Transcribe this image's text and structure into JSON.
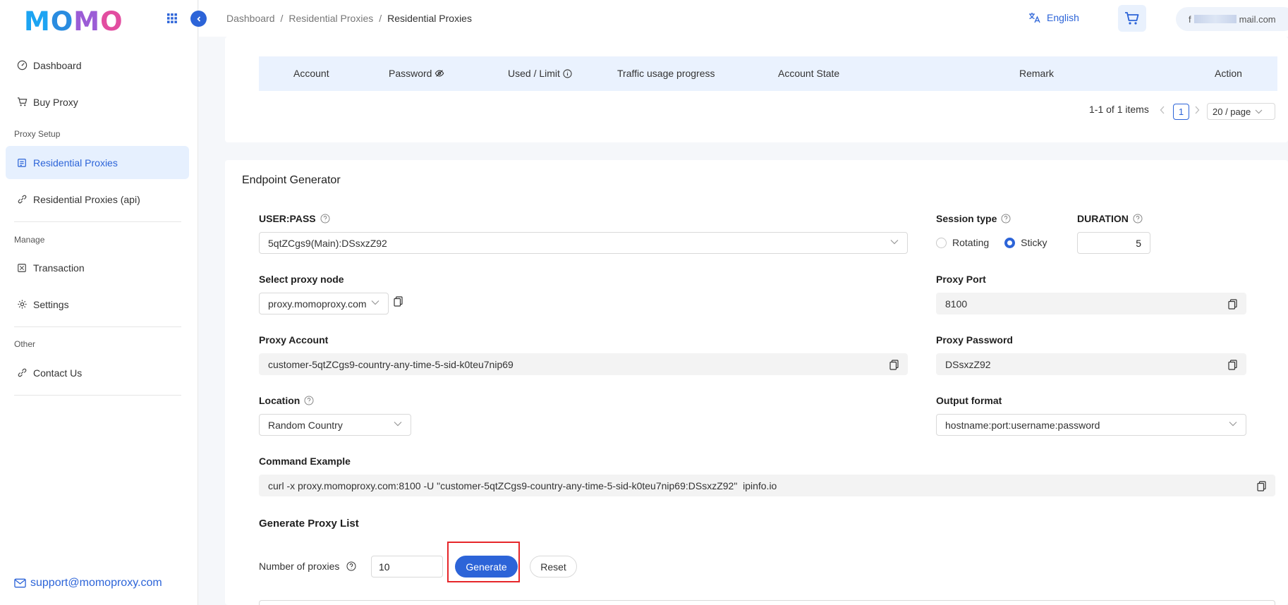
{
  "brand": {
    "logo_letters": [
      "M",
      "O",
      "M",
      "O"
    ]
  },
  "sidebar": {
    "items": [
      {
        "label": "Dashboard",
        "icon": "dashboard-icon"
      },
      {
        "label": "Buy Proxy",
        "icon": "cart-icon"
      },
      {
        "label": "Residential Proxies",
        "icon": "document-icon",
        "active": true
      },
      {
        "label": "Residential Proxies (api)",
        "icon": "api-link-icon"
      },
      {
        "label": "Transaction",
        "icon": "transaction-icon"
      },
      {
        "label": "Settings",
        "icon": "gear-icon"
      },
      {
        "label": "Contact Us",
        "icon": "link-icon"
      }
    ],
    "groups": {
      "proxy_setup": "Proxy Setup",
      "manage": "Manage",
      "other": "Other"
    },
    "support_email": "support@momoproxy.com"
  },
  "header": {
    "breadcrumbs": [
      "Dashboard",
      "/",
      "Residential Proxies",
      "/",
      "Residential Proxies"
    ],
    "language": "English",
    "user_email_prefix": "f",
    "user_email_suffix": "mail.com"
  },
  "accounts_table": {
    "columns": [
      "Account",
      "Password",
      "Used / Limit",
      "Traffic usage progress",
      "Account State",
      "Remark",
      "Action"
    ],
    "pagination": {
      "summary": "1-1 of 1 items",
      "page": "1",
      "page_size": "20 / page"
    }
  },
  "endpoint": {
    "title": "Endpoint Generator",
    "user_pass": {
      "label": "USER:PASS",
      "value": "5qtZCgs9(Main):DSsxzZ92"
    },
    "session_type": {
      "label": "Session type",
      "options": [
        "Rotating",
        "Sticky"
      ],
      "selected": "Sticky"
    },
    "duration": {
      "label": "DURATION",
      "value": "5"
    },
    "proxy_node": {
      "label": "Select proxy node",
      "value": "proxy.momoproxy.com"
    },
    "proxy_port": {
      "label": "Proxy Port",
      "value": "8100"
    },
    "proxy_account": {
      "label": "Proxy Account",
      "value": "customer-5qtZCgs9-country-any-time-5-sid-k0teu7nip69"
    },
    "proxy_password": {
      "label": "Proxy Password",
      "value": "DSsxzZ92"
    },
    "location": {
      "label": "Location",
      "value": "Random Country"
    },
    "output_format": {
      "label": "Output format",
      "value": "hostname:port:username:password"
    },
    "command": {
      "label": "Command Example",
      "value": "curl -x proxy.momoproxy.com:8100 -U \"customer-5qtZCgs9-country-any-time-5-sid-k0teu7nip69:DSsxzZ92\"  ipinfo.io"
    }
  },
  "generate": {
    "title": "Generate Proxy List",
    "count_label": "Number of proxies",
    "count_value": "10",
    "generate_label": "Generate",
    "reset_label": "Reset"
  },
  "colors": {
    "accent": "#2c64d8",
    "highlight": "#e6262a",
    "active_bg": "#e6f0fe",
    "table_header_bg": "#eaf2fe"
  }
}
